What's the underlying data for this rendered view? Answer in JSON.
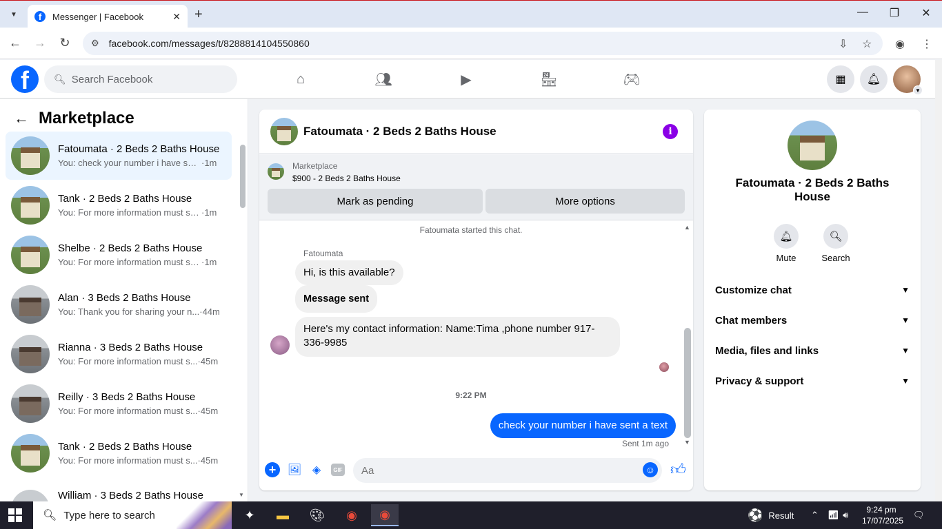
{
  "browser": {
    "tab_title": "Messenger | Facebook",
    "url": "facebook.com/messages/t/8288814104550860"
  },
  "fb_header": {
    "search_placeholder": "Search Facebook",
    "nav_icons": [
      "home-icon",
      "friends-icon",
      "video-icon",
      "marketplace-icon",
      "gaming-icon"
    ],
    "brand_color": "#0866ff"
  },
  "left_panel": {
    "title": "Marketplace",
    "conversations": [
      {
        "name": "Fatoumata · 2 Beds 2 Baths House",
        "preview": "You: check your number i have sen...",
        "time": "·1m",
        "active": true
      },
      {
        "name": "Tank · 2 Beds 2 Baths House",
        "preview": "You: For more information must se...",
        "time": "·1m"
      },
      {
        "name": "Shelbe · 2 Beds 2 Baths House",
        "preview": "You: For more information must se...",
        "time": "·1m"
      },
      {
        "name": "Alan · 3 Beds 2 Baths House",
        "preview": "You: Thank you for sharing your n...",
        "time": "·44m"
      },
      {
        "name": "Rianna · 3 Beds 2 Baths House",
        "preview": "You: For more information must s...",
        "time": "·45m"
      },
      {
        "name": "Reilly · 3 Beds 2 Baths House",
        "preview": "You: For more information must s...",
        "time": "·45m"
      },
      {
        "name": "Tank · 2 Beds 2 Baths House",
        "preview": "You: For more information must s...",
        "time": "·45m"
      },
      {
        "name": "William · 3 Beds 2 Baths House",
        "preview": "",
        "time": ""
      }
    ]
  },
  "chat": {
    "title": "Fatoumata · 2 Beds 2 Baths House",
    "marketplace_label": "Marketplace",
    "listing": "$900 - 2 Beds 2 Baths House",
    "btn_pending": "Mark as pending",
    "btn_more": "More options",
    "started": "Fatoumata started this chat.",
    "sender": "Fatoumata",
    "messages_in": [
      "Hi, is this available?",
      "Message sent",
      "Here's my contact information: Name:Tima ,phone number 917-336-9985"
    ],
    "time_sep": "9:22 PM",
    "message_out": "check your number i have sent a text",
    "sent_status": "Sent 1m ago",
    "composer_placeholder": "Aa"
  },
  "right_panel": {
    "name": "Fatoumata · 2 Beds 2 Baths House",
    "mute": "Mute",
    "search": "Search",
    "sections": [
      "Customize chat",
      "Chat members",
      "Media, files and links",
      "Privacy & support"
    ]
  },
  "taskbar": {
    "search_placeholder": "Type here to search",
    "result_label": "Result",
    "time": "9:24 pm",
    "date": "17/07/2025"
  }
}
